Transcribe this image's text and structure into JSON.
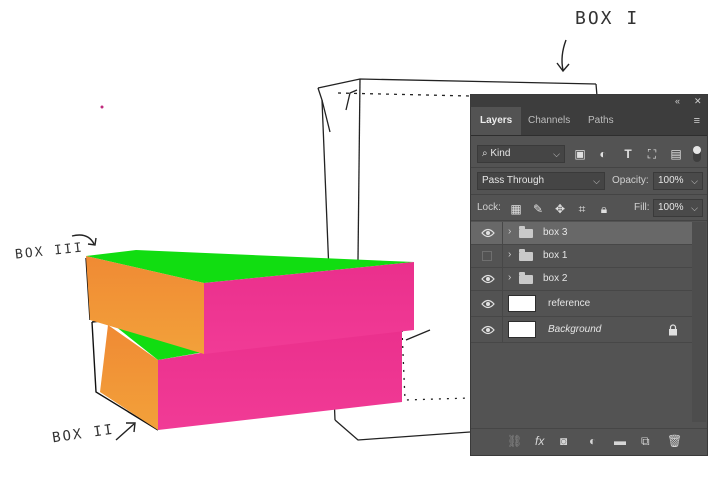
{
  "annotations": {
    "box1": "BOX I",
    "box2": "BOX II",
    "box3": "BOX III"
  },
  "colors": {
    "box_top": "#11dd11",
    "box_front": "#ee2e8e",
    "box_side_start": "#f08a34",
    "box_side_end": "#f2a13a",
    "panel_bg": "#535353"
  },
  "panel": {
    "tabs": [
      "Layers",
      "Channels",
      "Paths"
    ],
    "active_tab": "Layers",
    "filter": {
      "value": "Kind"
    },
    "blend_mode": "Pass Through",
    "opacity_label": "Opacity:",
    "opacity_value": "100%",
    "lock_label": "Lock:",
    "fill_label": "Fill:",
    "fill_value": "100%",
    "layers": [
      {
        "name": "box 3",
        "type": "group",
        "visible": true,
        "selected": true
      },
      {
        "name": "box 1",
        "type": "group",
        "visible": false,
        "selected": false
      },
      {
        "name": "box 2",
        "type": "group",
        "visible": true,
        "selected": false
      },
      {
        "name": "reference",
        "type": "image",
        "visible": true,
        "selected": false
      },
      {
        "name": "Background",
        "type": "background",
        "visible": true,
        "selected": false,
        "locked": true
      }
    ],
    "bottom_icons": [
      "link-icon",
      "fx-icon",
      "mask-icon",
      "adjustment-icon",
      "folder-icon",
      "new-layer-icon",
      "trash-icon"
    ],
    "filter_icons": [
      "image-filter-icon",
      "adjustment-filter-icon",
      "type-filter-icon",
      "shape-filter-icon",
      "smart-object-filter-icon"
    ],
    "lock_icons": [
      "lock-transparent-icon",
      "lock-paint-icon",
      "lock-position-icon",
      "lock-artboard-icon",
      "lock-all-icon"
    ]
  }
}
